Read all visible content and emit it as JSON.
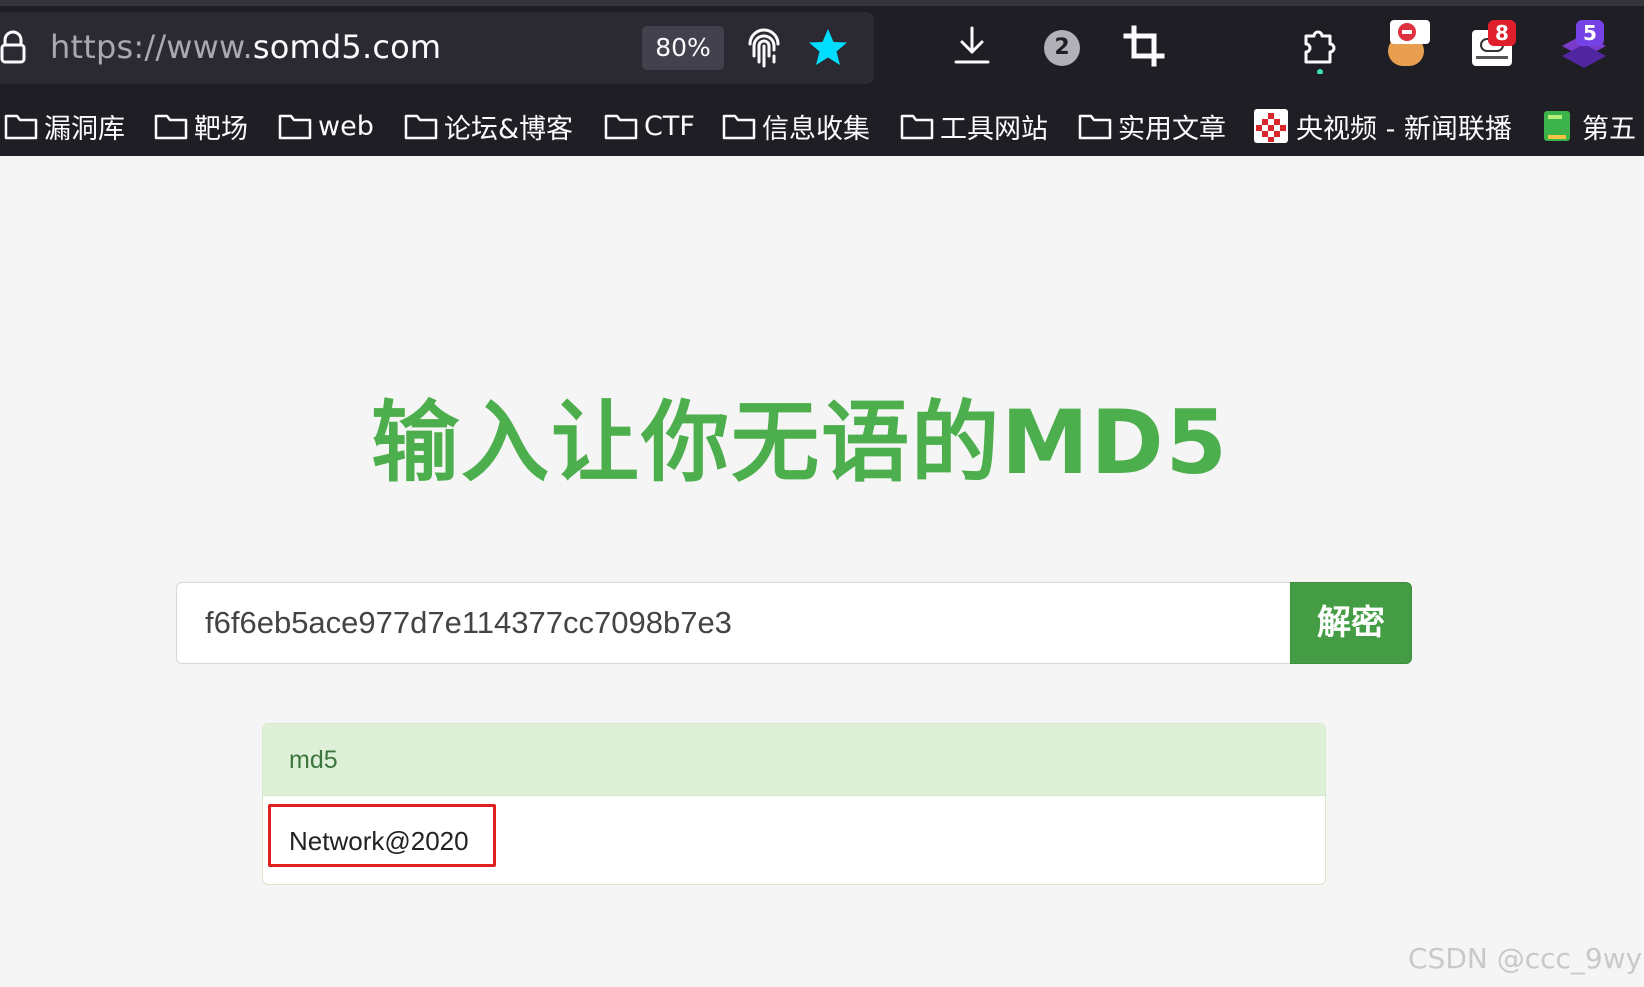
{
  "browser": {
    "url_scheme": "https://www.",
    "url_host": "somd5.com",
    "zoom": "80%",
    "toolbar_badges": {
      "tabs_count": "2",
      "ext_badge_1": "8",
      "ext_badge_2": "5"
    },
    "icons": [
      "lock-icon",
      "fingerprint-icon",
      "star-icon",
      "download-icon",
      "counter-icon",
      "crop-icon",
      "extensions-icon"
    ],
    "colors": {
      "chrome_bg": "#1f1e25",
      "urlbar_bg": "#2b2a33",
      "star": "#00ddff"
    }
  },
  "bookmarks": [
    {
      "label": "漏洞库",
      "type": "folder"
    },
    {
      "label": "靶场",
      "type": "folder"
    },
    {
      "label": "web",
      "type": "folder"
    },
    {
      "label": "论坛&博客",
      "type": "folder"
    },
    {
      "label": "CTF",
      "type": "folder"
    },
    {
      "label": "信息收集",
      "type": "folder"
    },
    {
      "label": "工具网站",
      "type": "folder"
    },
    {
      "label": "实用文章",
      "type": "folder"
    },
    {
      "label": "央视频 - 新闻联播",
      "type": "site"
    },
    {
      "label": "第五",
      "type": "site"
    }
  ],
  "page": {
    "title": "输入让你无语的MD5",
    "search_value": "f6f6eb5ace977d7e114377cc7098b7e3",
    "decrypt_label": "解密",
    "result": {
      "header": "md5",
      "value": "Network@2020"
    },
    "colors": {
      "accent": "#4cae4c",
      "button": "#449d44",
      "panel_head": "#dff0d8",
      "highlight": "#e0201f"
    }
  },
  "watermark": "CSDN @ccc_9wy"
}
